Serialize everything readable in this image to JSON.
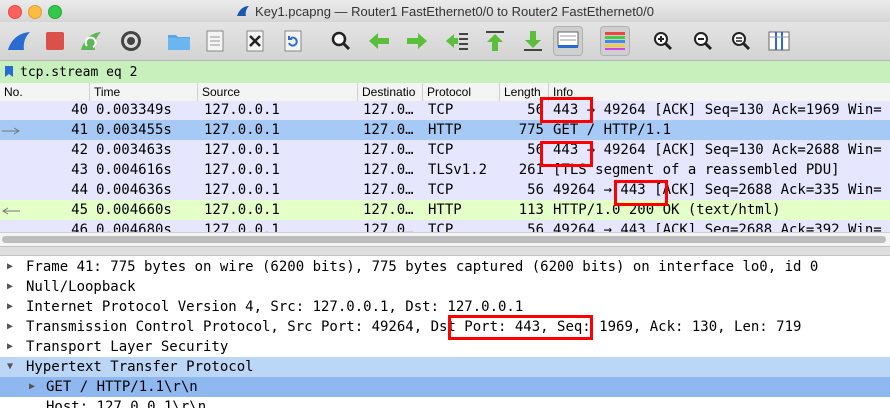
{
  "window": {
    "title": "Key1.pcapng — Router1 FastEthernet0/0 to Router2 FastEthernet0/0"
  },
  "toolbar": {
    "buttons": [
      {
        "name": "start-capture-button",
        "icon": "shark-fin-icon"
      },
      {
        "name": "stop-capture-button",
        "icon": "stop-square-icon"
      },
      {
        "name": "restart-capture-button",
        "icon": "restart-fin-icon"
      },
      {
        "name": "capture-options-button",
        "icon": "gear-icon"
      },
      {
        "name": "open-file-button",
        "icon": "folder-icon"
      },
      {
        "name": "save-file-button",
        "icon": "document-icon"
      },
      {
        "name": "close-file-button",
        "icon": "close-file-icon"
      },
      {
        "name": "reload-file-button",
        "icon": "reload-icon"
      },
      {
        "name": "find-packet-button",
        "icon": "search-icon"
      },
      {
        "name": "go-back-button",
        "icon": "arrow-left-icon"
      },
      {
        "name": "go-forward-button",
        "icon": "arrow-right-icon"
      },
      {
        "name": "go-to-packet-button",
        "icon": "goto-packet-icon"
      },
      {
        "name": "first-packet-button",
        "icon": "arrow-up-icon"
      },
      {
        "name": "last-packet-button",
        "icon": "arrow-down-icon"
      },
      {
        "name": "autoscroll-button",
        "icon": "autoscroll-icon"
      },
      {
        "name": "colorize-button",
        "icon": "colorize-icon"
      },
      {
        "name": "zoom-in-button",
        "icon": "zoom-in-icon"
      },
      {
        "name": "zoom-out-button",
        "icon": "zoom-out-icon"
      },
      {
        "name": "normal-size-button",
        "icon": "zoom-reset-icon"
      },
      {
        "name": "resize-columns-button",
        "icon": "resize-columns-icon"
      }
    ]
  },
  "filter": {
    "value": "tcp.stream eq 2"
  },
  "packet_list": {
    "columns": [
      "No.",
      "Time",
      "Source",
      "Destinatio",
      "Protocol",
      "Length",
      "Info"
    ],
    "rows": [
      {
        "no": "40",
        "time": "0.003349s",
        "src": "127.0.0.1",
        "dst": "127.0…",
        "proto": "TCP",
        "len": "56",
        "info": "443 → 49264 [ACK] Seq=130 Ack=1969 Win=",
        "bg": "#e7e6ff"
      },
      {
        "no": "41",
        "time": "0.003455s",
        "src": "127.0.0.1",
        "dst": "127.0…",
        "proto": "HTTP",
        "len": "775",
        "info": "GET / HTTP/1.1",
        "bg": "#a7c9f5"
      },
      {
        "no": "42",
        "time": "0.003463s",
        "src": "127.0.0.1",
        "dst": "127.0…",
        "proto": "TCP",
        "len": "56",
        "info": "443 → 49264 [ACK] Seq=130 Ack=2688 Win=",
        "bg": "#e7e6ff"
      },
      {
        "no": "43",
        "time": "0.004616s",
        "src": "127.0.0.1",
        "dst": "127.0…",
        "proto": "TLSv1.2",
        "len": "261",
        "info": "[TLS segment of a reassembled PDU]",
        "bg": "#e7e6ff"
      },
      {
        "no": "44",
        "time": "0.004636s",
        "src": "127.0.0.1",
        "dst": "127.0…",
        "proto": "TCP",
        "len": "56",
        "info": "49264 → 443 [ACK] Seq=2688 Ack=335 Win=",
        "bg": "#e7e6ff"
      },
      {
        "no": "45",
        "time": "0.004660s",
        "src": "127.0.0.1",
        "dst": "127.0…",
        "proto": "HTTP",
        "len": "113",
        "info": "HTTP/1.0 200 OK  (text/html)",
        "bg": "#e4ffc7"
      },
      {
        "no": "46",
        "time": "0.004680s",
        "src": "127.0.0.1",
        "dst": "127.0…",
        "proto": "TCP",
        "len": "56",
        "info": "49264 → 443 [ACK] Seq=2688 Ack=392 Win=",
        "bg": "#e7e6ff"
      }
    ]
  },
  "details": {
    "rows": [
      {
        "text": "Frame 41: 775 bytes on wire (6200 bits), 775 bytes captured (6200 bits) on interface lo0, id 0",
        "expanded": false,
        "level": 0
      },
      {
        "text": "Null/Loopback",
        "expanded": false,
        "level": 0
      },
      {
        "text": "Internet Protocol Version 4, Src: 127.0.0.1, Dst: 127.0.0.1",
        "expanded": false,
        "level": 0
      },
      {
        "text": "Transmission Control Protocol, Src Port: 49264, Dst Port: 443, Seq: 1969, Ack: 130, Len: 719",
        "expanded": false,
        "level": 0
      },
      {
        "text": "Transport Layer Security",
        "expanded": false,
        "level": 0
      },
      {
        "text": "Hypertext Transfer Protocol",
        "expanded": true,
        "level": 0
      },
      {
        "text": "GET / HTTP/1.1\\r\\n",
        "expanded": false,
        "level": 1
      },
      {
        "text": "Host: 127.0.0.1\\r\\n",
        "expanded": null,
        "level": 1
      }
    ]
  },
  "colors": {
    "filter_bg": "#c8f0bd",
    "selected_row": "#a7c9f5",
    "tcp_row": "#e7e6ff",
    "http_response_row": "#e4ffc7",
    "highlight_box": "#ff0000",
    "details_highlight": "#bcd6f7",
    "details_selected": "#8fb8f0"
  }
}
